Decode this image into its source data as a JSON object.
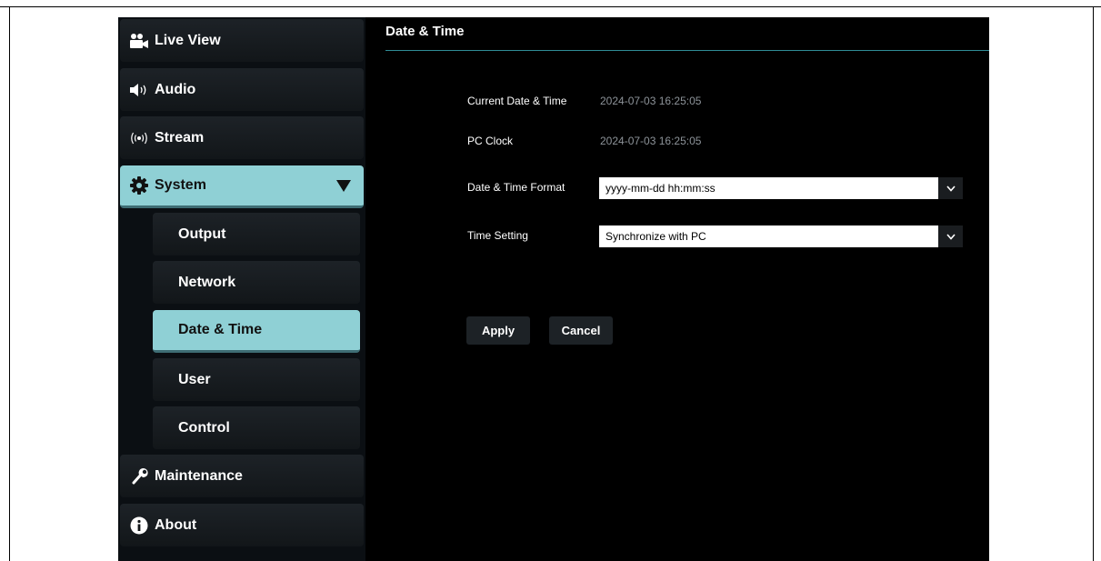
{
  "sidebar": {
    "items": [
      {
        "label": "Live View",
        "icon": "video-camera-icon"
      },
      {
        "label": "Audio",
        "icon": "speaker-icon"
      },
      {
        "label": "Stream",
        "icon": "broadcast-icon"
      },
      {
        "label": "System",
        "icon": "gear-icon",
        "expanded": true
      },
      {
        "label": "Maintenance",
        "icon": "wrench-icon"
      },
      {
        "label": "About",
        "icon": "info-icon"
      }
    ],
    "system_subitems": [
      {
        "label": "Output"
      },
      {
        "label": "Network"
      },
      {
        "label": "Date & Time",
        "active": true
      },
      {
        "label": "User"
      },
      {
        "label": "Control"
      }
    ],
    "active_color": "#8fd0d5"
  },
  "main": {
    "title": "Date & Time",
    "fields": {
      "current_date_time": {
        "label": "Current Date & Time",
        "value": "2024-07-03 16:25:05"
      },
      "pc_clock": {
        "label": "PC Clock",
        "value": "2024-07-03 16:25:05"
      },
      "date_time_format": {
        "label": "Date & Time Format",
        "selected": "yyyy-mm-dd hh:mm:ss"
      },
      "time_setting": {
        "label": "Time Setting",
        "selected": "Synchronize with PC"
      }
    },
    "buttons": {
      "apply": "Apply",
      "cancel": "Cancel"
    }
  }
}
